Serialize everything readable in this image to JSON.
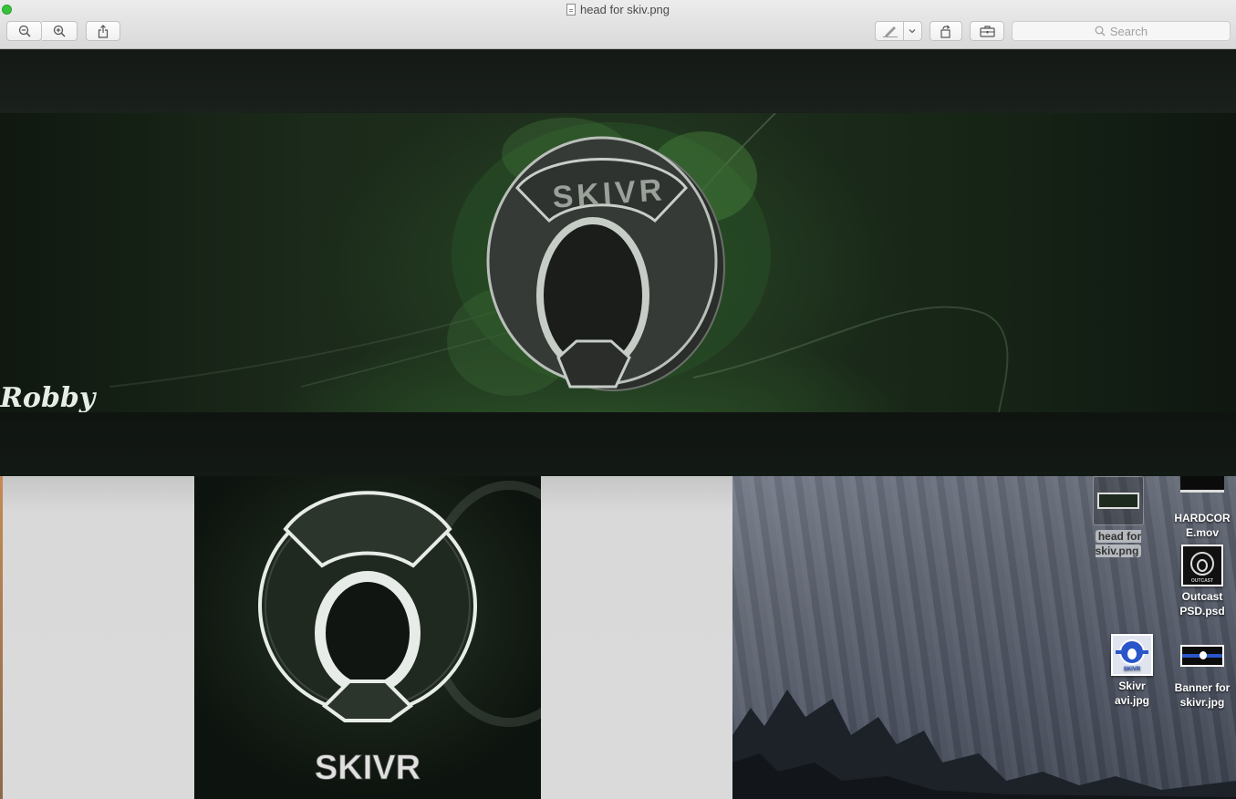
{
  "window": {
    "title": "head for skiv.png"
  },
  "toolbar": {
    "zoom_out_icon": "zoom-out-icon",
    "zoom_in_icon": "zoom-in-icon",
    "share_icon": "share-icon",
    "markup_icon": "pen-icon",
    "rotate_icon": "rotate-icon",
    "toolbox_icon": "toolbox-icon",
    "search_placeholder": "Search"
  },
  "image": {
    "banner_logo_text": "SKIVR",
    "signature_text": "Robby"
  },
  "avatar": {
    "brand_text": "SKIVR"
  },
  "desktop": {
    "icons": [
      {
        "label": "head for\nskiv.png",
        "selected": true
      },
      {
        "label": "HARDCOR\nE.mov",
        "selected": false
      },
      {
        "label": "Outcast\nPSD.psd",
        "selected": false
      },
      {
        "label": "Skivr\navi.jpg",
        "selected": false
      },
      {
        "label": "Banner for\nskivr.jpg",
        "selected": false
      }
    ],
    "outcast_thumb_text": "OUTCAST",
    "skivr_thumb_text": "SKIVR"
  },
  "colors": {
    "accent_green": "#2e5a2a",
    "traffic_green": "#38c23c"
  }
}
